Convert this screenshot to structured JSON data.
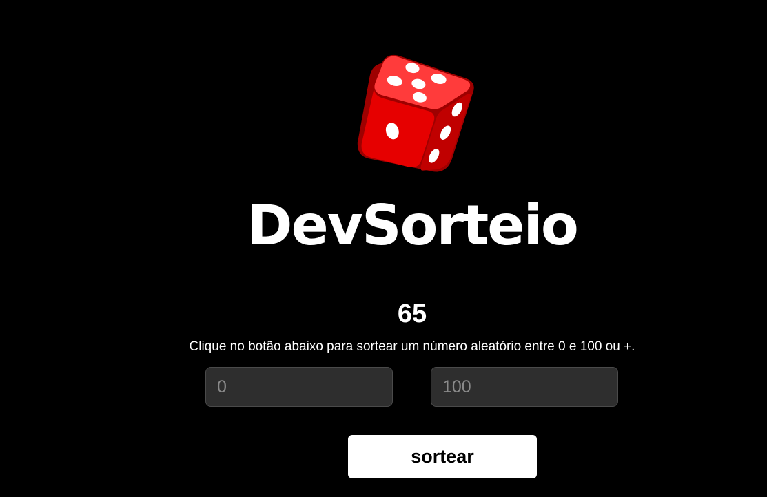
{
  "brand": {
    "title": "DevSorteio",
    "logo_icon": "dice-icon",
    "accent_color": "#e00000"
  },
  "result": {
    "value": "65"
  },
  "instructions": {
    "text": "Clique no botão abaixo para sortear um número aleatório entre 0 e 100 ou +."
  },
  "inputs": {
    "min_placeholder": "0",
    "max_placeholder": "100"
  },
  "actions": {
    "draw_label": "sortear"
  }
}
